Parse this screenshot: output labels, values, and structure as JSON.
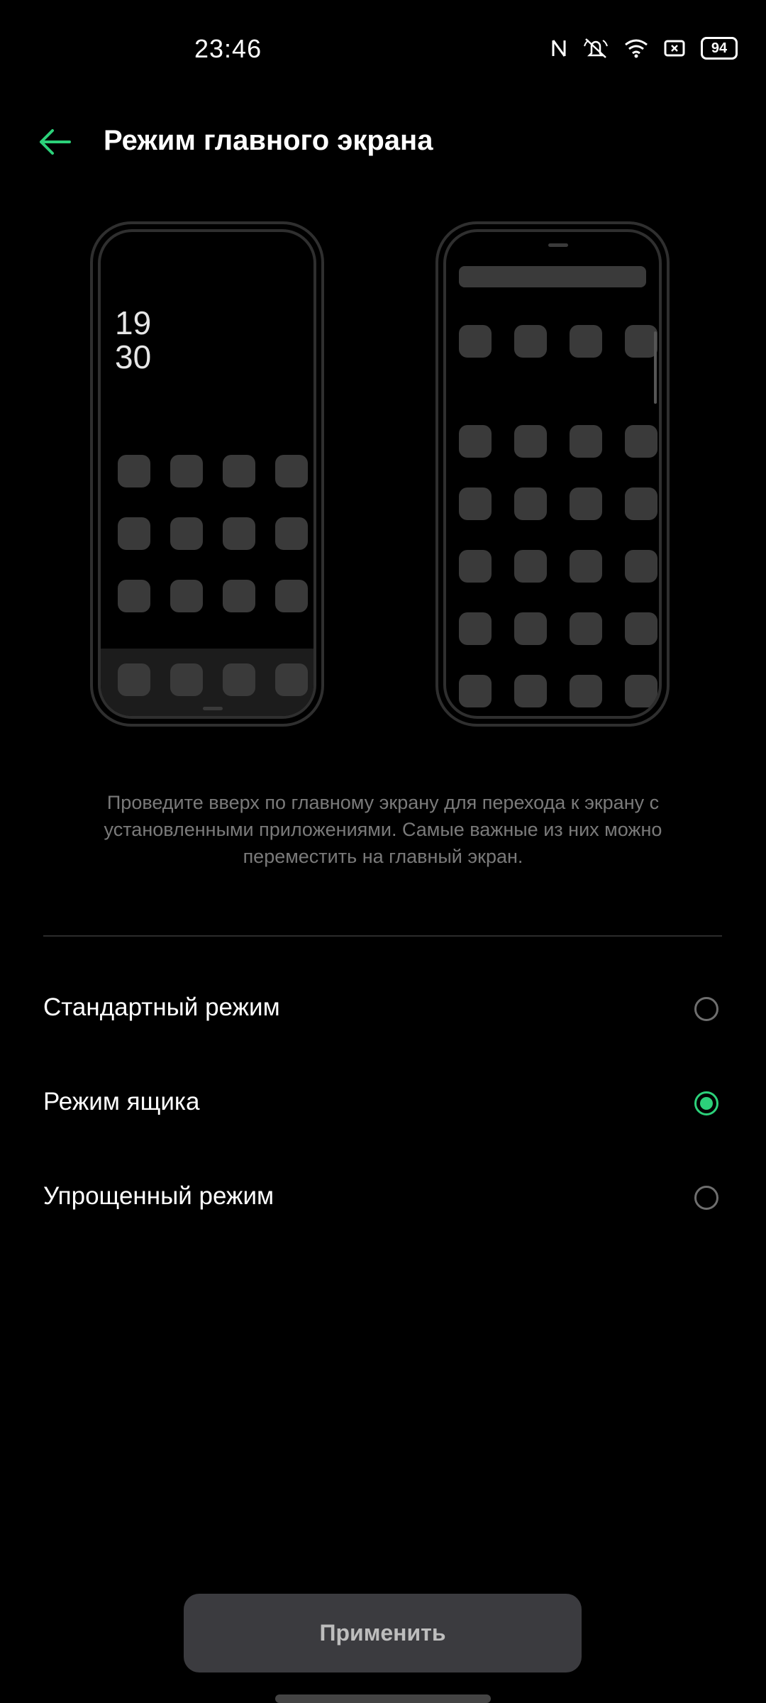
{
  "status_bar": {
    "time": "23:46",
    "battery": "94",
    "icons": [
      "nfc-icon",
      "mute-icon",
      "wifi-icon",
      "screen-record-icon",
      "battery-icon"
    ]
  },
  "header": {
    "title": "Режим главного экрана",
    "back_icon": "arrow-left-icon",
    "accent": "#2cd17a"
  },
  "preview": {
    "clock_hours": "19",
    "clock_minutes": "30"
  },
  "description": "Проведите вверх по главному экрану для перехода к экрану с установленными приложениями. Самые важные из них можно переместить на главный экран.",
  "options": [
    {
      "label": "Стандартный режим",
      "selected": false
    },
    {
      "label": "Режим ящика",
      "selected": true
    },
    {
      "label": "Упрощенный режим",
      "selected": false
    }
  ],
  "apply_button": "Применить"
}
